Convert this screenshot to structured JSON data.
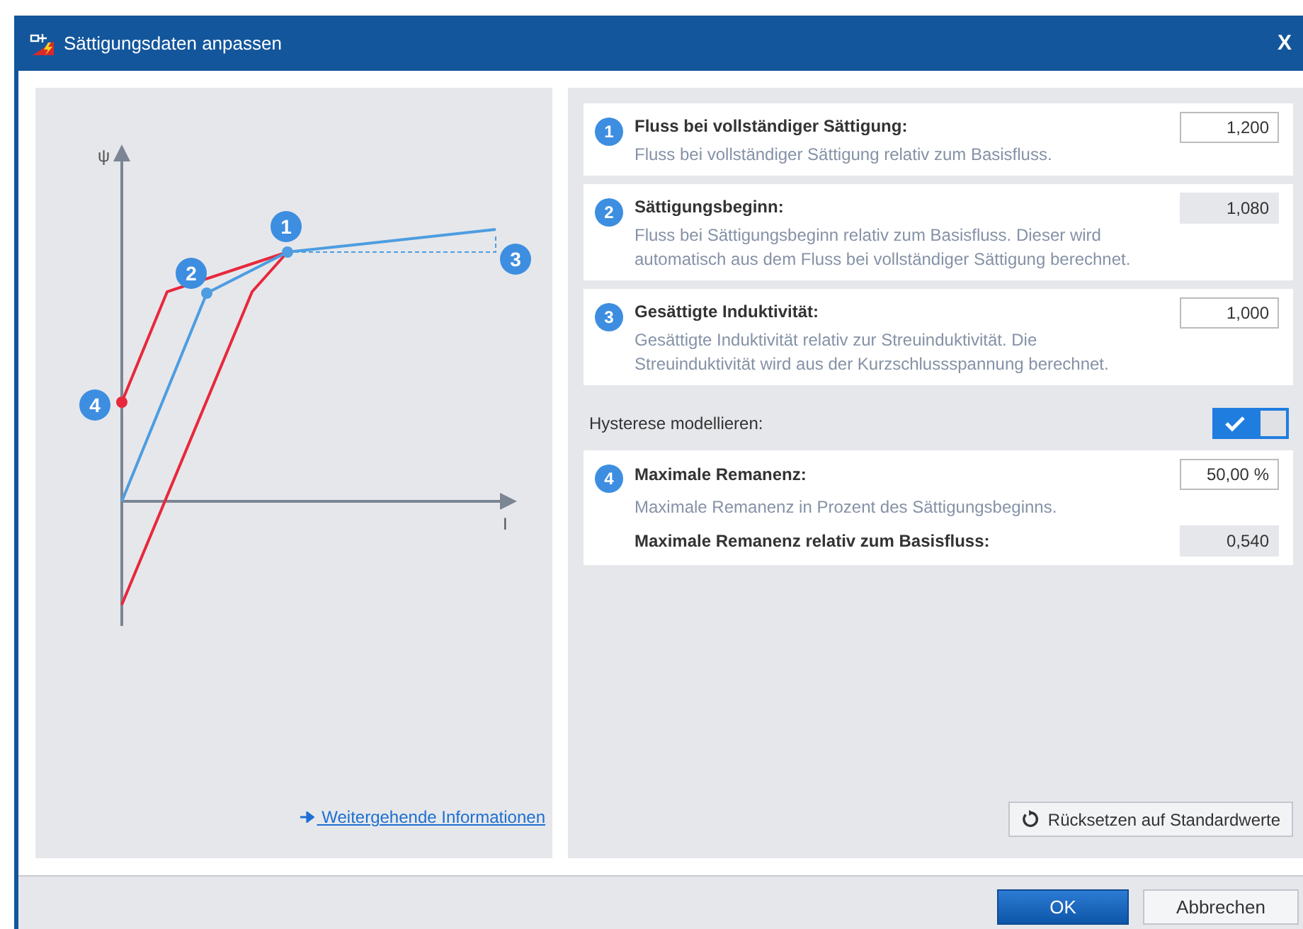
{
  "window": {
    "title": "Sättigungsdaten anpassen",
    "close": "X"
  },
  "diagram": {
    "y_axis_label": "ψ",
    "x_axis_label": "I",
    "markers": [
      "1",
      "2",
      "3",
      "4"
    ]
  },
  "info_link": "Weitergehende Informationen",
  "sections": [
    {
      "number": "1",
      "title": "Fluss bei vollständiger Sättigung:",
      "description": "Fluss bei vollständiger Sättigung relativ zum Basisfluss.",
      "value": "1,200",
      "editable": true
    },
    {
      "number": "2",
      "title": "Sättigungsbeginn:",
      "description": "Fluss bei Sättigungsbeginn relativ zum Basisfluss. Dieser wird automatisch aus dem Fluss bei vollständiger Sättigung berechnet.",
      "value": "1,080",
      "editable": false
    },
    {
      "number": "3",
      "title": "Gesättigte Induktivität:",
      "description": "Gesättigte Induktivität relativ zur Streuinduktivität. Die Streuinduktivität wird aus der Kurzschlussspannung berechnet.",
      "value": "1,000",
      "editable": true
    }
  ],
  "hysteresis": {
    "label": "Hysterese modellieren:",
    "on": true
  },
  "remanence": {
    "number": "4",
    "title": "Maximale Remanenz:",
    "description": "Maximale Remanenz in Prozent des Sättigungsbeginns.",
    "value": "50,00 %",
    "editable": true,
    "derived_label": "Maximale Remanenz relativ zum Basisfluss:",
    "derived_value": "0,540",
    "derived_editable": false
  },
  "reset_button": "Rücksetzen auf Standardwerte",
  "buttons": [
    {
      "label": "OK",
      "kind": "primary"
    },
    {
      "label": "Abbrechen",
      "kind": "secondary"
    }
  ]
}
